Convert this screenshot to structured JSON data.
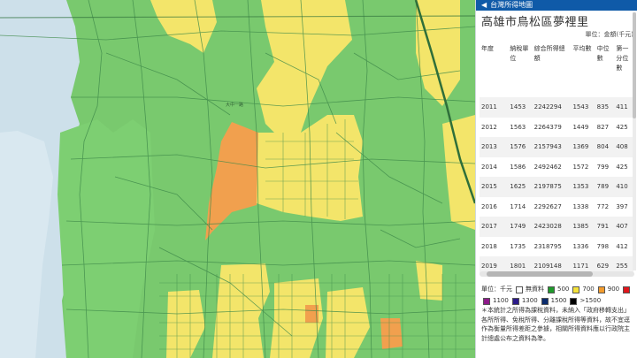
{
  "app": {
    "title": "台灣所得地圖",
    "back_icon": "chevron-left-icon"
  },
  "place": {
    "title": "高雄市鳥松區夢裡里",
    "unit_note": "單位：金額(千元)"
  },
  "table": {
    "headers": [
      "年度",
      "納稅單位",
      "綜合所得總額",
      "平均數",
      "中位數",
      "第一分位數"
    ],
    "rows": [
      [
        "2011",
        "1453",
        "2242294",
        "1543",
        "835",
        "411"
      ],
      [
        "2012",
        "1563",
        "2264379",
        "1449",
        "827",
        "425"
      ],
      [
        "2013",
        "1576",
        "2157943",
        "1369",
        "804",
        "408"
      ],
      [
        "2014",
        "1586",
        "2492462",
        "1572",
        "799",
        "425"
      ],
      [
        "2015",
        "1625",
        "2197875",
        "1353",
        "789",
        "410"
      ],
      [
        "2016",
        "1714",
        "2292627",
        "1338",
        "772",
        "397"
      ],
      [
        "2017",
        "1749",
        "2423028",
        "1385",
        "791",
        "407"
      ],
      [
        "2018",
        "1735",
        "2318795",
        "1336",
        "798",
        "412"
      ],
      [
        "2019",
        "1801",
        "2109148",
        "1171",
        "629",
        "255"
      ]
    ]
  },
  "legend": {
    "unit_label": "單位：千元",
    "items": [
      {
        "label": "無資料",
        "color": "#ffffff"
      },
      {
        "label": "500",
        "color": "#1f9a2b"
      },
      {
        "label": "700",
        "color": "#f4e23a"
      },
      {
        "label": "900",
        "color": "#f39c2d"
      },
      {
        "label": "",
        "color": "#e0161c"
      },
      {
        "label": "1100",
        "color": "#8e1a8a"
      },
      {
        "label": "1300",
        "color": "#2b1a8a"
      },
      {
        "label": "1500",
        "color": "#0b2c6e"
      },
      {
        "label": ">1500",
        "color": "#000000"
      }
    ]
  },
  "notes": "＊本統計之所得為課稅資料，未納入「政府移轉支出」各所所得、免稅所得、分離課稅所得等資料，故不宜逕作為衡量所得差距之參據，相關所得資料應以行政院主計總處公布之資料為準。",
  "map_colors": {
    "land": "#79c96e",
    "road": "#3f8a4a",
    "sea": "#c6dde8",
    "yellow": "#f3e56a",
    "orange": "#f1a04e"
  }
}
